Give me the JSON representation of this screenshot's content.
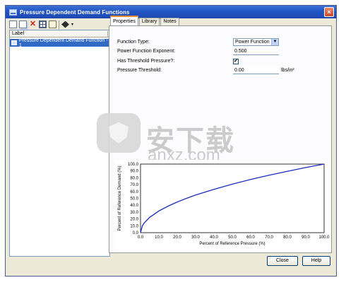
{
  "window": {
    "title": "Pressure Dependent Demand Functions",
    "close_glyph": "×"
  },
  "toolbar": {
    "icons": [
      "new-icon",
      "copy-icon",
      "delete-icon",
      "table-icon",
      "report-icon",
      "fill-icon",
      "dropdown-caret-icon"
    ],
    "delete_glyph": "✕",
    "caret_glyph": "▾"
  },
  "list": {
    "header": "Label",
    "items": [
      {
        "label": "Pressure Dependent Demand Function - 1",
        "selected": true
      }
    ]
  },
  "tabs": [
    {
      "label": "Properties",
      "active": true
    },
    {
      "label": "Library",
      "active": false
    },
    {
      "label": "Notes",
      "active": false
    }
  ],
  "properties": {
    "function_type": {
      "label": "Function Type:",
      "value": "Power Function",
      "arrow": "▼"
    },
    "exponent": {
      "label": "Power Function Exponent:",
      "value": "0.500"
    },
    "has_threshold": {
      "label": "Has Threshold Pressure?:",
      "checked": true,
      "check_glyph": "✔"
    },
    "threshold": {
      "label": "Pressure Threshold:",
      "value": "0.00",
      "unit": "lbs/in²"
    }
  },
  "chart_data": {
    "type": "line",
    "xlabel": "Percent of Reference Pressure (%)",
    "ylabel": "Percent of Reference Demand (%)",
    "xlim": [
      0,
      100
    ],
    "ylim": [
      0,
      100
    ],
    "x_ticks": [
      "0.0",
      "10.0",
      "20.0",
      "30.0",
      "40.0",
      "50.0",
      "60.0",
      "70.0",
      "80.0",
      "90.0",
      "100.0"
    ],
    "y_ticks": [
      "0.0",
      "10.0",
      "20.0",
      "30.0",
      "40.0",
      "50.0",
      "60.0",
      "70.0",
      "80.0",
      "90.0",
      "100.0"
    ],
    "grid": true,
    "series": [
      {
        "color": "#1a2dbf",
        "x": [
          0,
          1,
          2,
          5,
          10,
          15,
          20,
          25,
          30,
          40,
          50,
          60,
          70,
          80,
          90,
          100
        ],
        "y": [
          0,
          10,
          14.1,
          22.4,
          31.6,
          38.7,
          44.7,
          50,
          54.8,
          63.2,
          70.7,
          77.5,
          83.7,
          89.4,
          94.9,
          100
        ]
      }
    ]
  },
  "buttons": {
    "close": "Close",
    "help": "Help"
  },
  "watermark": {
    "text_cn": "安下载",
    "text_en": "anxz.com"
  }
}
